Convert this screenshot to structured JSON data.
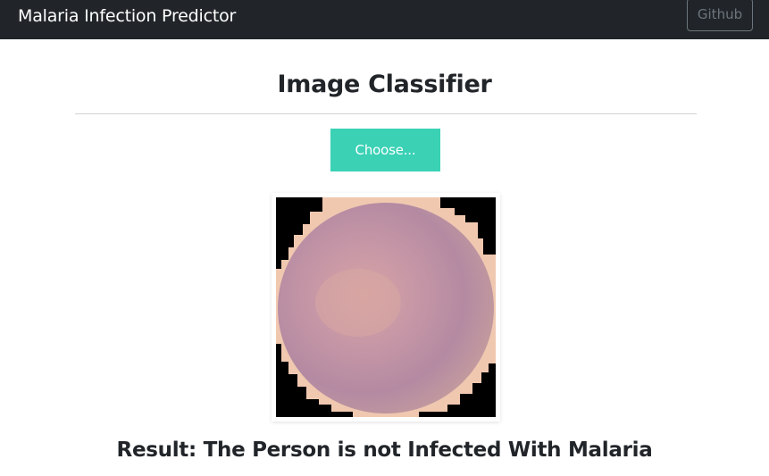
{
  "navbar": {
    "brand": "Malaria Infection Predictor",
    "github_label": "Github"
  },
  "main": {
    "title": "Image Classifier",
    "choose_label": "Choose...",
    "result": "Result: The Person is not Infected With Malaria"
  },
  "colors": {
    "navbar_bg": "#212529",
    "button_accent": "#3ad1b5",
    "cell_color": "#b98aa0"
  }
}
